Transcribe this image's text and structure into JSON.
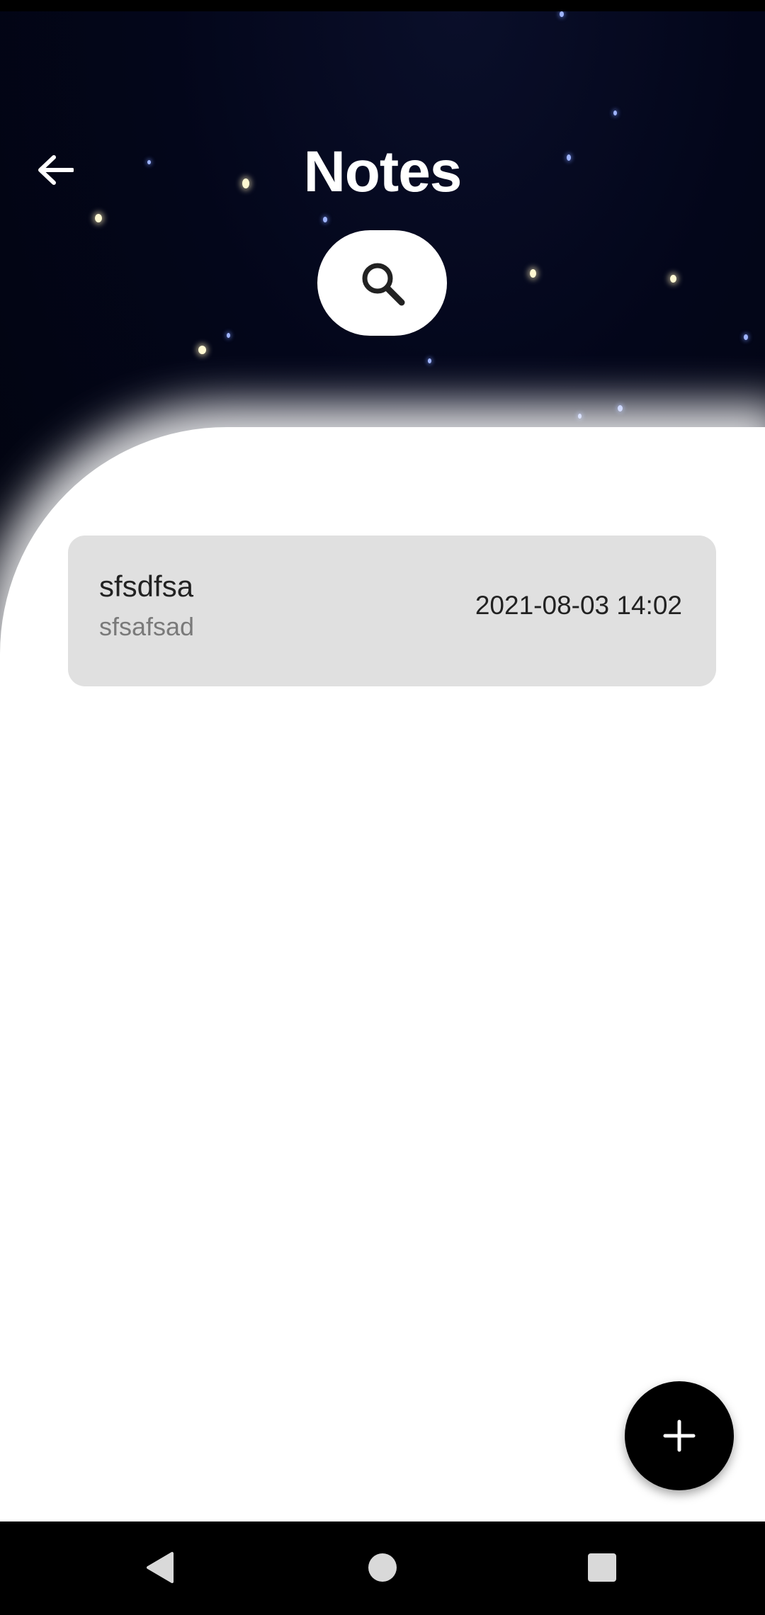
{
  "header": {
    "title": "Notes"
  },
  "notes": [
    {
      "title": "sfsdfsa",
      "body": "sfsafsad",
      "date": "2021-08-03 14:02"
    }
  ],
  "icons": {
    "back": "arrow-back-icon",
    "search": "search-icon",
    "add": "plus-icon",
    "nav_back": "triangle-back-icon",
    "nav_home": "circle-home-icon",
    "nav_recents": "square-recents-icon"
  },
  "colors": {
    "sky": "#02040f",
    "card": "#e0e0e0",
    "fab": "#000000",
    "title": "#ffffff"
  }
}
